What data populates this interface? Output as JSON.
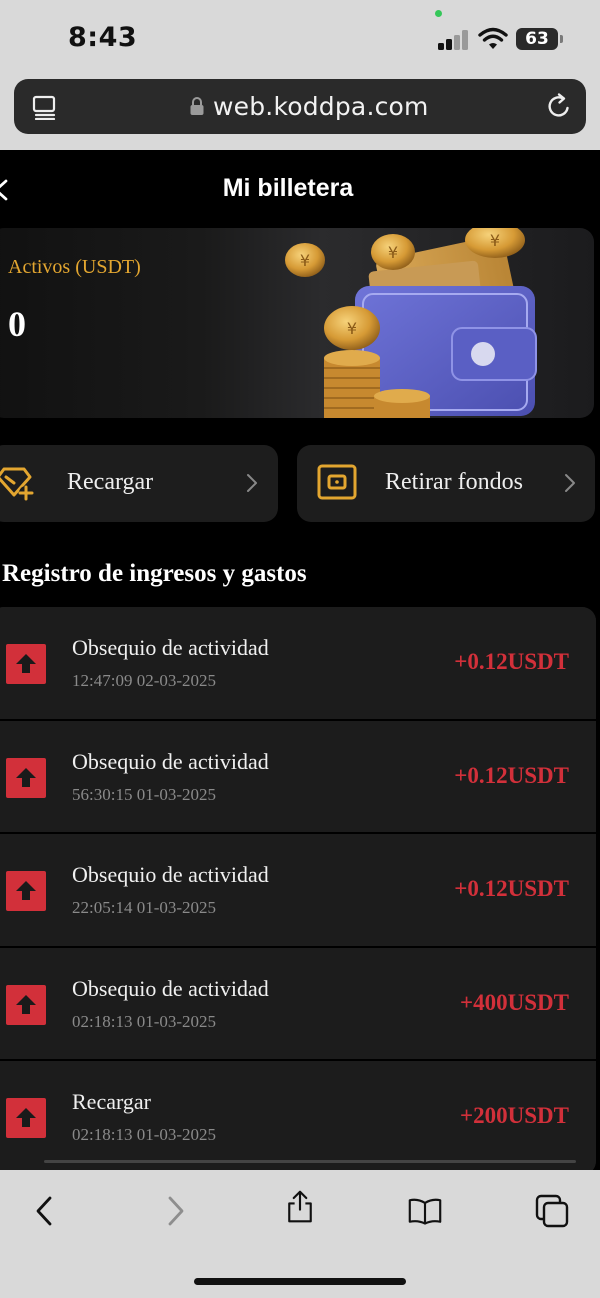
{
  "status_bar": {
    "time": "8:43",
    "battery": "63"
  },
  "browser": {
    "url": "web.koddpa.com"
  },
  "header": {
    "title": "Mi billetera"
  },
  "wallet": {
    "assets_label": "Activos (USDT)",
    "assets_value": "0"
  },
  "actions": {
    "recharge_label": "Recargar",
    "withdraw_label": "Retirar fondos"
  },
  "records": {
    "title": "Registro de ingresos y gastos",
    "items": [
      {
        "name": "Obsequio de actividad",
        "time": "12:47:09 02-03-2025",
        "amount": "+0.12USDT"
      },
      {
        "name": "Obsequio de actividad",
        "time": "56:30:15 01-03-2025",
        "amount": "+0.12USDT"
      },
      {
        "name": "Obsequio de actividad",
        "time": "22:05:14 01-03-2025",
        "amount": "+0.12USDT"
      },
      {
        "name": "Obsequio de actividad",
        "time": "02:18:13 01-03-2025",
        "amount": "+400USDT"
      },
      {
        "name": "Recargar",
        "time": "02:18:13 01-03-2025",
        "amount": "+200USDT"
      }
    ]
  },
  "colors": {
    "accent_gold": "#e3a630",
    "amount_red": "#d2303a"
  },
  "icons": [
    "back-icon",
    "tabs-icon",
    "lock-icon",
    "reload-icon",
    "recharge-icon",
    "withdraw-icon",
    "chevron-right-icon",
    "arrow-up-icon",
    "share-icon",
    "bookmarks-icon",
    "tab-overview-icon"
  ]
}
